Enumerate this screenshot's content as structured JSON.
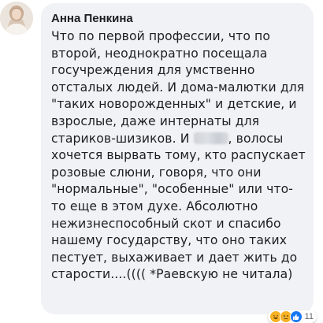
{
  "comment": {
    "author": "Анна Пенкина",
    "segments": {
      "before_redaction": "Что по первой профессии, что по второй, неоднократно посещала госучреждения для умственно отсталых людей. И дома-малютки для \"таких новорожденных\" и детские, и взрослые, даже интернаты для стариков-шизиков. И ",
      "after_redaction": ", волосы хочется вырвать тому, кто распускает розовые слюни, говоря, что они \"нормальные\", \"особенные\" или что-то еще в этом духе. Абсолютно нежизнеспособный скот и спасибо нашему государству, что оно таких пестует, выхаживает и дает жить до старости....(((( *Раевскую не читала)"
    },
    "reactions": {
      "icons": [
        "haha-icon",
        "sad-icon",
        "like-icon"
      ],
      "count": "11"
    }
  },
  "colors": {
    "bubble_bg": "#f0f2f5",
    "text": "#1c1e21",
    "like_blue": "#1877f2",
    "emoji_yellow": "#f7b125"
  }
}
